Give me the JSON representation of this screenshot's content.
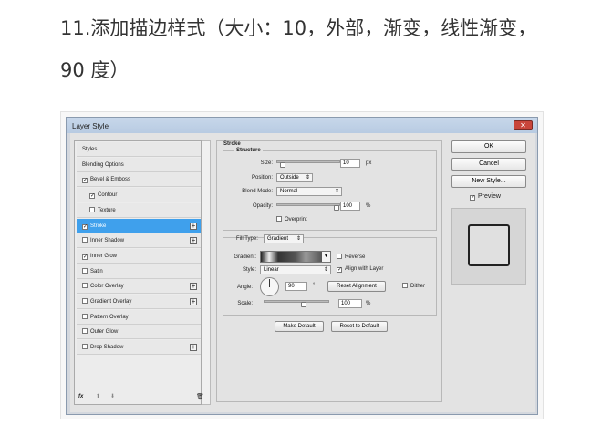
{
  "heading": "11.添加描边样式（大小：10，外部，渐变，线性渐变，90 度）",
  "dialog": {
    "title": "Layer Style",
    "close_icon": "close-icon",
    "list": [
      {
        "label": "Styles"
      },
      {
        "label": "Blending Options"
      },
      {
        "label": "Bevel & Emboss",
        "checked": true
      },
      {
        "label": "Contour",
        "checked": true,
        "indent": true
      },
      {
        "label": "Texture",
        "checked": false,
        "indent": true
      },
      {
        "label": "Stroke",
        "checked": true,
        "selected": true,
        "plus": true
      },
      {
        "label": "Inner Shadow",
        "checked": false,
        "plus": true
      },
      {
        "label": "Inner Glow",
        "checked": true
      },
      {
        "label": "Satin",
        "checked": false
      },
      {
        "label": "Color Overlay",
        "checked": false,
        "plus": true
      },
      {
        "label": "Gradient Overlay",
        "checked": false,
        "plus": true
      },
      {
        "label": "Pattern Overlay",
        "checked": false
      },
      {
        "label": "Outer Glow",
        "checked": false
      },
      {
        "label": "Drop Shadow",
        "checked": false,
        "plus": true
      }
    ],
    "fx_label": "fx",
    "stroke": {
      "title": "Stroke",
      "structure": "Structure",
      "size_label": "Size:",
      "size_value": "10",
      "size_unit": "px",
      "position_label": "Position:",
      "position_value": "Outside",
      "blend_label": "Blend Mode:",
      "blend_value": "Normal",
      "opacity_label": "Opacity:",
      "opacity_value": "100",
      "opacity_unit": "%",
      "overprint": "Overprint",
      "filltype_label": "Fill Type:",
      "filltype_value": "Gradient",
      "gradient_label": "Gradient:",
      "reverse": "Reverse",
      "style_label": "Style:",
      "style_value": "Linear",
      "align": "Align with Layer",
      "angle_label": "Angle:",
      "angle_value": "90",
      "angle_unit": "°",
      "reset_alignment": "Reset Alignment",
      "dither": "Dither",
      "scale_label": "Scale:",
      "scale_value": "100",
      "scale_unit": "%",
      "make_default": "Make Default",
      "reset_default": "Reset to Default"
    },
    "ok": "OK",
    "cancel": "Cancel",
    "new_style": "New Style...",
    "preview": "Preview"
  }
}
